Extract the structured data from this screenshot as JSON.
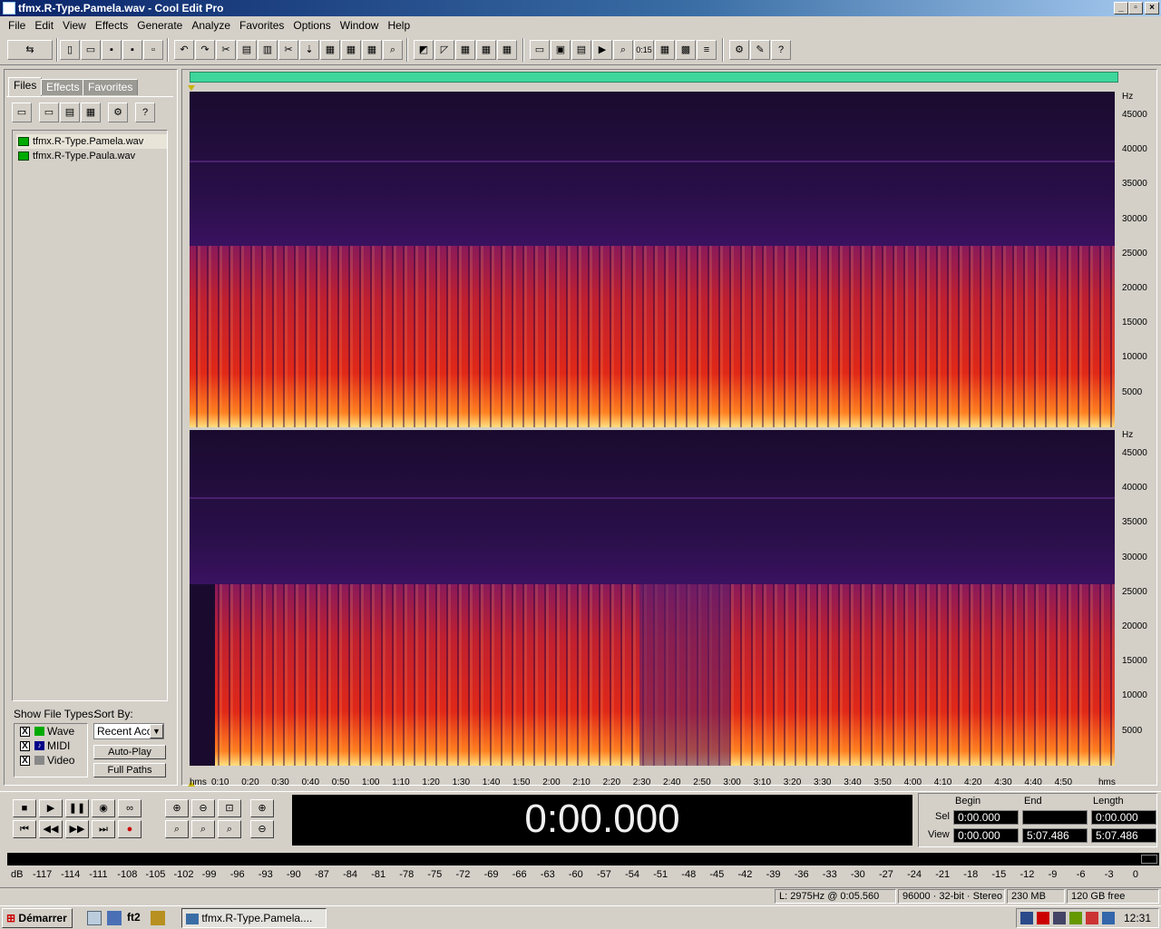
{
  "window": {
    "title": "tfmx.R-Type.Pamela.wav - Cool Edit Pro"
  },
  "menu": [
    "File",
    "Edit",
    "View",
    "Effects",
    "Generate",
    "Analyze",
    "Favorites",
    "Options",
    "Window",
    "Help"
  ],
  "panel": {
    "tabs": [
      "Files",
      "Effects",
      "Favorites"
    ],
    "files": [
      "tfmx.R-Type.Pamela.wav",
      "tfmx.R-Type.Paula.wav"
    ],
    "show_file_types_label": "Show File Types:",
    "sort_by_label": "Sort By:",
    "types": [
      {
        "label": "Wave",
        "checked": "X"
      },
      {
        "label": "MIDI",
        "checked": "X"
      },
      {
        "label": "Video",
        "checked": "X"
      }
    ],
    "sort_value": "Recent Acc",
    "auto_play": "Auto-Play",
    "full_paths": "Full Paths"
  },
  "spectrum": {
    "hz_unit": "Hz",
    "hz_ticks": [
      "45000",
      "40000",
      "35000",
      "30000",
      "25000",
      "20000",
      "15000",
      "10000",
      "5000"
    ],
    "time_unit": "hms",
    "time_ticks": [
      "0:10",
      "0:20",
      "0:30",
      "0:40",
      "0:50",
      "1:00",
      "1:10",
      "1:20",
      "1:30",
      "1:40",
      "1:50",
      "2:00",
      "2:10",
      "2:20",
      "2:30",
      "2:40",
      "2:50",
      "3:00",
      "3:10",
      "3:20",
      "3:30",
      "3:40",
      "3:50",
      "4:00",
      "4:10",
      "4:20",
      "4:30",
      "4:40",
      "4:50"
    ]
  },
  "transport": {
    "time": "0:00.000",
    "begin_label": "Begin",
    "end_label": "End",
    "length_label": "Length",
    "sel_label": "Sel",
    "view_label": "View",
    "sel_begin": "0:00.000",
    "sel_end": "",
    "sel_length": "0:00.000",
    "view_begin": "0:00.000",
    "view_end": "5:07.486",
    "view_length": "5:07.486"
  },
  "meter": {
    "unit": "dB",
    "ticks": [
      "-117",
      "-114",
      "-111",
      "-108",
      "-105",
      "-102",
      "-99",
      "-96",
      "-93",
      "-90",
      "-87",
      "-84",
      "-81",
      "-78",
      "-75",
      "-72",
      "-69",
      "-66",
      "-63",
      "-60",
      "-57",
      "-54",
      "-51",
      "-48",
      "-45",
      "-42",
      "-39",
      "-36",
      "-33",
      "-30",
      "-27",
      "-24",
      "-21",
      "-18",
      "-15",
      "-12",
      "-9",
      "-6",
      "-3",
      "0"
    ]
  },
  "status": {
    "cursor": "L: 2975Hz @   0:05.560",
    "format": "96000 · 32-bit · Stereo",
    "size": "230 MB",
    "free": "120 GB free"
  },
  "taskbar": {
    "start": "Démarrer",
    "quick_label": "ft2",
    "task": "tfmx.R-Type.Pamela....",
    "clock": "12:31"
  },
  "colors": {
    "spectrum_bg": "#1a0b2e",
    "spectrum_hot": "#ff3a1a",
    "overview": "#3ed69a"
  }
}
